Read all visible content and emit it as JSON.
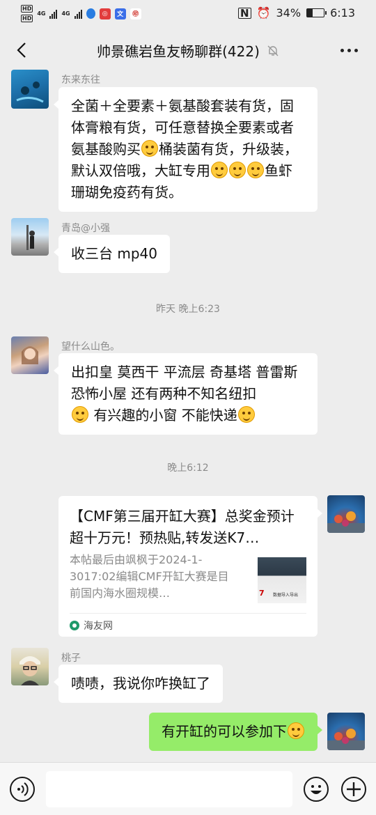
{
  "status_bar": {
    "hd1": "HD",
    "hd2": "HD",
    "net1": "4G",
    "net2": "4G",
    "battery_percent": "34%",
    "battery_level": 0.34,
    "time": "6:13"
  },
  "header": {
    "back_icon": "chevron-left-icon",
    "title": "帅景礁岩鱼友畅聊群(422)",
    "mute_icon": "bell-muted-icon",
    "more_icon": "more-dots-icon"
  },
  "messages": [
    {
      "sender": "东来东往",
      "text_parts": [
        "全菌＋全要素＋氨基酸套装有货，固体膏粮有货，可任意替换全要素或者氨基酸购买",
        "桶装菌有货，升级装，默认双倍哦，大缸专用",
        "鱼虾珊瑚免疫药有货。"
      ]
    },
    {
      "sender": "青岛@小强",
      "text": "收三台 mp40"
    },
    {
      "timestamp": "昨天 晚上6:23"
    },
    {
      "sender": "望什么山色。",
      "text_parts": [
        "出扣皇 莫西干 平流层 奇基塔 普雷斯 恐怖小屋 还有两种不知名纽扣",
        " 有兴趣的小窗 不能快递"
      ]
    },
    {
      "timestamp": "晚上6:12"
    },
    {
      "card": {
        "title": "【CMF第三届开缸大赛】总奖金预计超十万元！预热贴,转发送K7…",
        "description": "本帖最后由飒枫于2024-1-3017:02编辑CMF开缸大赛是目前国内海水圈规模…",
        "thumb_text": "7",
        "thumb_caption": "数据导入导出",
        "source": "海友网"
      }
    },
    {
      "sender": "桃子",
      "text": "啧啧，我说你咋换缸了"
    },
    {
      "self_text": "有开缸的可以参加下"
    }
  ],
  "input_bar": {
    "voice_icon": "voice-icon",
    "emoji_icon": "emoji-icon",
    "plus_icon": "plus-icon",
    "input_value": ""
  }
}
